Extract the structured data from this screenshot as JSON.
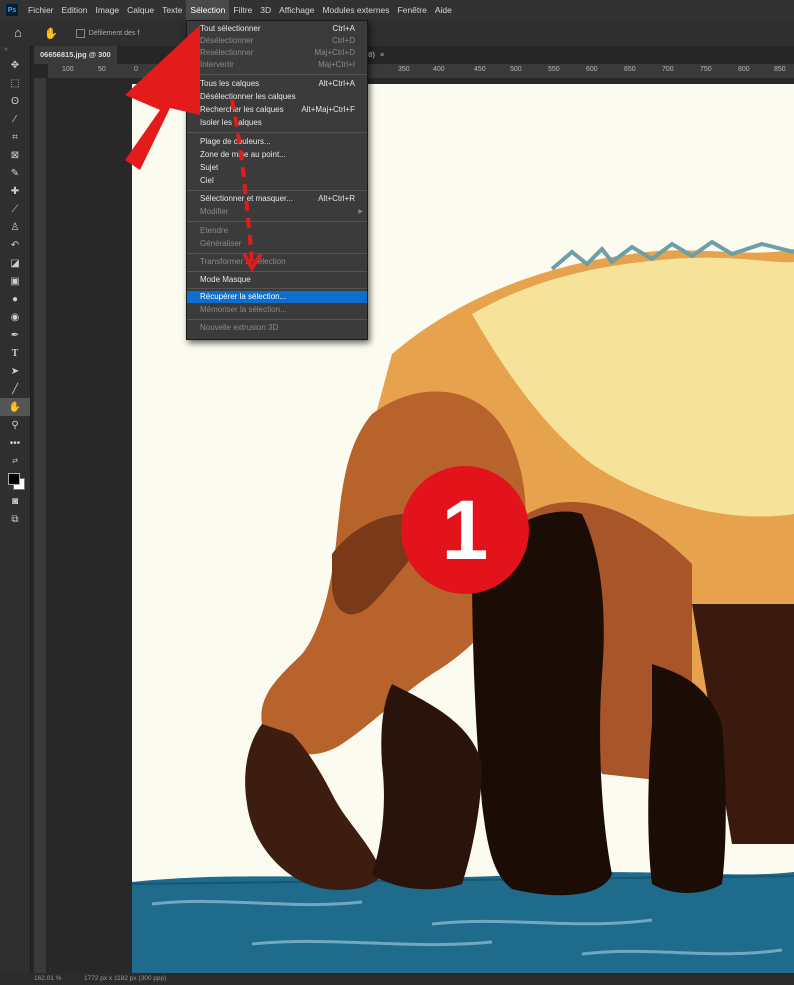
{
  "app": {
    "logo": "Ps"
  },
  "menubar": {
    "items": [
      "Fichier",
      "Edition",
      "Image",
      "Calque",
      "Texte",
      "Sélection",
      "Filtre",
      "3D",
      "Affichage",
      "Modules externes",
      "Fenêtre",
      "Aide"
    ],
    "active_index": 5
  },
  "options_bar": {
    "scroll_label": "Défilement des f"
  },
  "document": {
    "tab_title": "06656815.jpg @ 300",
    "tab_suffix": "78)",
    "close_glyph": "×"
  },
  "ruler": {
    "h_ticks": [
      "100",
      "50",
      "0",
      "350",
      "400",
      "450",
      "500",
      "550",
      "600",
      "650",
      "700",
      "750",
      "800",
      "850"
    ]
  },
  "status": {
    "zoom": "162,01 %",
    "info": "1772 px x 1182 px (300 ppp)"
  },
  "selection_menu": {
    "items": [
      {
        "label": "Tout sélectionner",
        "shortcut": "Ctrl+A",
        "enabled": true
      },
      {
        "label": "Désélectionner",
        "shortcut": "Ctrl+D",
        "enabled": false
      },
      {
        "label": "Resélectionner",
        "shortcut": "Maj+Ctrl+D",
        "enabled": false
      },
      {
        "label": "Intervertir",
        "shortcut": "Maj+Ctrl+I",
        "enabled": false
      },
      {
        "label": "Tous les calques",
        "shortcut": "Alt+Ctrl+A",
        "enabled": true
      },
      {
        "label": "Désélectionner les calques",
        "shortcut": "",
        "enabled": true
      },
      {
        "label": "Rechercher les calques",
        "shortcut": "Alt+Maj+Ctrl+F",
        "enabled": true
      },
      {
        "label": "Isoler les calques",
        "shortcut": "",
        "enabled": true
      },
      {
        "label": "Plage de couleurs...",
        "shortcut": "",
        "enabled": true
      },
      {
        "label": "Zone de mise au point...",
        "shortcut": "",
        "enabled": true
      },
      {
        "label": "Sujet",
        "shortcut": "",
        "enabled": true
      },
      {
        "label": "Ciel",
        "shortcut": "",
        "enabled": true
      },
      {
        "label": "Sélectionner et masquer...",
        "shortcut": "Alt+Ctrl+R",
        "enabled": true
      },
      {
        "label": "Modifier",
        "shortcut": "",
        "enabled": false,
        "submenu": "▶"
      },
      {
        "label": "Etendre",
        "shortcut": "",
        "enabled": false
      },
      {
        "label": "Généraliser",
        "shortcut": "",
        "enabled": false
      },
      {
        "label": "Transformer la sélection",
        "shortcut": "",
        "enabled": false
      },
      {
        "label": "Mode Masque",
        "shortcut": "",
        "enabled": true
      },
      {
        "label": "Récupérer la sélection...",
        "shortcut": "",
        "enabled": true,
        "highlighted": true
      },
      {
        "label": "Mémoriser la sélection...",
        "shortcut": "",
        "enabled": false
      },
      {
        "label": "Nouvelle extrusion 3D",
        "shortcut": "",
        "enabled": false
      }
    ]
  },
  "callout": {
    "number": "1"
  },
  "tools": [
    "move-icon",
    "marquee-icon",
    "lasso-icon",
    "magic-wand-icon",
    "crop-icon",
    "frame-icon",
    "eyedropper-icon",
    "healing-brush-icon",
    "brush-icon",
    "clone-stamp-icon",
    "history-brush-icon",
    "eraser-icon",
    "gradient-icon",
    "blur-icon",
    "dodge-icon",
    "pen-icon",
    "type-icon",
    "path-select-icon",
    "line-icon",
    "hand-icon",
    "zoom-icon",
    "more-tools-icon",
    "swap-colors-icon",
    "color-swatches-icon",
    "quick-mask-icon",
    "screen-mode-icon"
  ],
  "colors": {
    "accent": "#0d6ecd",
    "arrow": "#e41b1b",
    "badge": "#e3131b"
  }
}
